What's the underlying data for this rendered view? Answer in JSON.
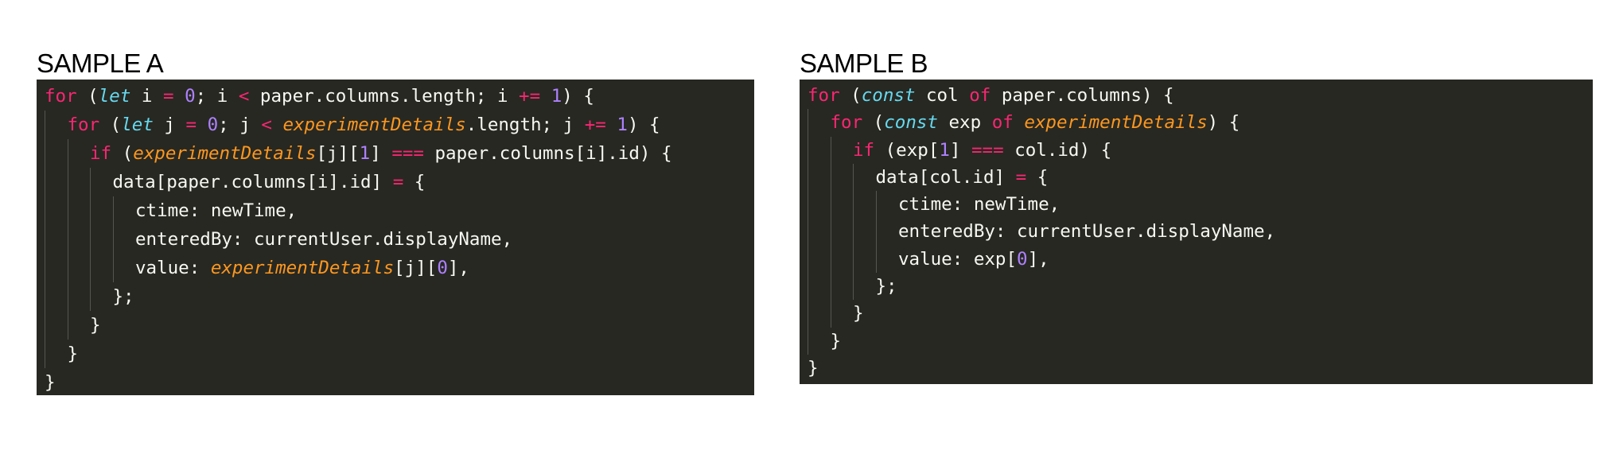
{
  "colors": {
    "background": "#ffffff",
    "code_background": "#272822",
    "plain": "#f8f8f2",
    "keyword": "#f92672",
    "storage": "#66d9ef",
    "number": "#ae81ff",
    "parameter": "#fd971f",
    "indent_guide": "#55564f"
  },
  "samples": [
    {
      "title": "SAMPLE A",
      "lines": [
        {
          "indent": 0,
          "tokens": [
            [
              "kw",
              "for"
            ],
            [
              "p",
              " ("
            ],
            [
              "st",
              "let"
            ],
            [
              "p",
              " i "
            ],
            [
              "kw",
              "="
            ],
            [
              "p",
              " "
            ],
            [
              "num",
              "0"
            ],
            [
              "p",
              "; i "
            ],
            [
              "kw",
              "<"
            ],
            [
              "p",
              " paper.columns.length; i "
            ],
            [
              "kw",
              "+="
            ],
            [
              "p",
              " "
            ],
            [
              "num",
              "1"
            ],
            [
              "p",
              ") {"
            ]
          ]
        },
        {
          "indent": 1,
          "tokens": [
            [
              "kw",
              "for"
            ],
            [
              "p",
              " ("
            ],
            [
              "st",
              "let"
            ],
            [
              "p",
              " j "
            ],
            [
              "kw",
              "="
            ],
            [
              "p",
              " "
            ],
            [
              "num",
              "0"
            ],
            [
              "p",
              "; j "
            ],
            [
              "kw",
              "<"
            ],
            [
              "p",
              " "
            ],
            [
              "param",
              "experimentDetails"
            ],
            [
              "p",
              ".length; j "
            ],
            [
              "kw",
              "+="
            ],
            [
              "p",
              " "
            ],
            [
              "num",
              "1"
            ],
            [
              "p",
              ") {"
            ]
          ]
        },
        {
          "indent": 2,
          "tokens": [
            [
              "kw",
              "if"
            ],
            [
              "p",
              " ("
            ],
            [
              "param",
              "experimentDetails"
            ],
            [
              "p",
              "[j]["
            ],
            [
              "num",
              "1"
            ],
            [
              "p",
              "] "
            ],
            [
              "kw",
              "==="
            ],
            [
              "p",
              " paper.columns[i].id) {"
            ]
          ]
        },
        {
          "indent": 3,
          "tokens": [
            [
              "p",
              "data[paper.columns[i].id] "
            ],
            [
              "kw",
              "="
            ],
            [
              "p",
              " {"
            ]
          ]
        },
        {
          "indent": 4,
          "tokens": [
            [
              "p",
              "ctime: newTime,"
            ]
          ]
        },
        {
          "indent": 4,
          "tokens": [
            [
              "p",
              "enteredBy: currentUser.displayName,"
            ]
          ]
        },
        {
          "indent": 4,
          "tokens": [
            [
              "p",
              "value: "
            ],
            [
              "param",
              "experimentDetails"
            ],
            [
              "p",
              "[j]["
            ],
            [
              "num",
              "0"
            ],
            [
              "p",
              "],"
            ]
          ]
        },
        {
          "indent": 3,
          "tokens": [
            [
              "p",
              "};"
            ]
          ]
        },
        {
          "indent": 2,
          "tokens": [
            [
              "p",
              "}"
            ]
          ]
        },
        {
          "indent": 1,
          "tokens": [
            [
              "p",
              "}"
            ]
          ]
        },
        {
          "indent": 0,
          "tokens": [
            [
              "p",
              "}"
            ]
          ]
        }
      ]
    },
    {
      "title": "SAMPLE B",
      "lines": [
        {
          "indent": 0,
          "tokens": [
            [
              "kw",
              "for"
            ],
            [
              "p",
              " ("
            ],
            [
              "st",
              "const"
            ],
            [
              "p",
              " col "
            ],
            [
              "kw",
              "of"
            ],
            [
              "p",
              " paper.columns) {"
            ]
          ]
        },
        {
          "indent": 1,
          "tokens": [
            [
              "kw",
              "for"
            ],
            [
              "p",
              " ("
            ],
            [
              "st",
              "const"
            ],
            [
              "p",
              " exp "
            ],
            [
              "kw",
              "of"
            ],
            [
              "p",
              " "
            ],
            [
              "param",
              "experimentDetails"
            ],
            [
              "p",
              ") {"
            ]
          ]
        },
        {
          "indent": 2,
          "tokens": [
            [
              "kw",
              "if"
            ],
            [
              "p",
              " (exp["
            ],
            [
              "num",
              "1"
            ],
            [
              "p",
              "] "
            ],
            [
              "kw",
              "==="
            ],
            [
              "p",
              " col.id) {"
            ]
          ]
        },
        {
          "indent": 3,
          "tokens": [
            [
              "p",
              "data[col.id] "
            ],
            [
              "kw",
              "="
            ],
            [
              "p",
              " {"
            ]
          ]
        },
        {
          "indent": 4,
          "tokens": [
            [
              "p",
              "ctime: newTime,"
            ]
          ]
        },
        {
          "indent": 4,
          "tokens": [
            [
              "p",
              "enteredBy: currentUser.displayName,"
            ]
          ]
        },
        {
          "indent": 4,
          "tokens": [
            [
              "p",
              "value: exp["
            ],
            [
              "num",
              "0"
            ],
            [
              "p",
              "],"
            ]
          ]
        },
        {
          "indent": 3,
          "tokens": [
            [
              "p",
              "};"
            ]
          ]
        },
        {
          "indent": 2,
          "tokens": [
            [
              "p",
              "}"
            ]
          ]
        },
        {
          "indent": 1,
          "tokens": [
            [
              "p",
              "}"
            ]
          ]
        },
        {
          "indent": 0,
          "tokens": [
            [
              "p",
              "}"
            ]
          ]
        }
      ]
    }
  ]
}
